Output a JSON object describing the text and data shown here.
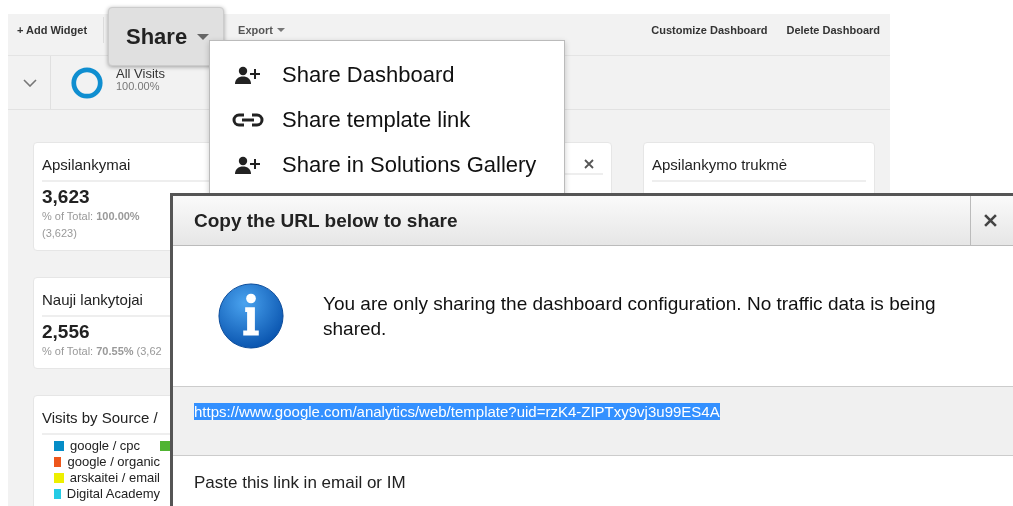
{
  "toolbar": {
    "add_widget": "+ Add Widget",
    "share": {
      "label": "Share",
      "expanded": true
    },
    "export": "Export",
    "right_links": [
      "Customize Dashboard",
      "Delete Dashboard"
    ]
  },
  "segment": {
    "name": "All Visits",
    "percent": "100.00%"
  },
  "widgets": [
    {
      "kind": "metric",
      "title": "Apsilankymai",
      "value": "3,623",
      "note": "% of Total: **100.00%** (3,623)"
    },
    {
      "kind": "metric",
      "title": "Nauji lankytojai",
      "value": "2,556",
      "note": "% of Total: **70.55%** (3,62"
    },
    {
      "kind": "legend",
      "title": "Visits by Source /",
      "legend": [
        {
          "label": "google / cpc",
          "color": "#058dc7"
        },
        {
          "color": "#50b432"
        },
        {
          "label": "google / organic",
          "color": "#ed561b"
        },
        {
          "label": "arskaitei / email",
          "color": "#edef00"
        },
        {
          "label": "Digital Academy",
          "color": "#24cbe5"
        }
      ]
    }
  ],
  "right_widget": {
    "title": "Apsilankymo trukmė"
  },
  "share_menu": [
    {
      "kind": "invite",
      "label": "Share Dashboard"
    },
    {
      "kind": "link",
      "label": "Share template link"
    },
    {
      "kind": "invite",
      "label": "Share in Solutions Gallery"
    }
  ],
  "dialog": {
    "title": "Copy the URL below to share",
    "message": "You are only sharing the dashboard configuration. No traffic data is being shared.",
    "url": "https://www.google.com/analytics/web/template?uid=rzK4-ZIPTxy9vj3u99ES4A",
    "hint": "Paste this link in email or IM"
  }
}
